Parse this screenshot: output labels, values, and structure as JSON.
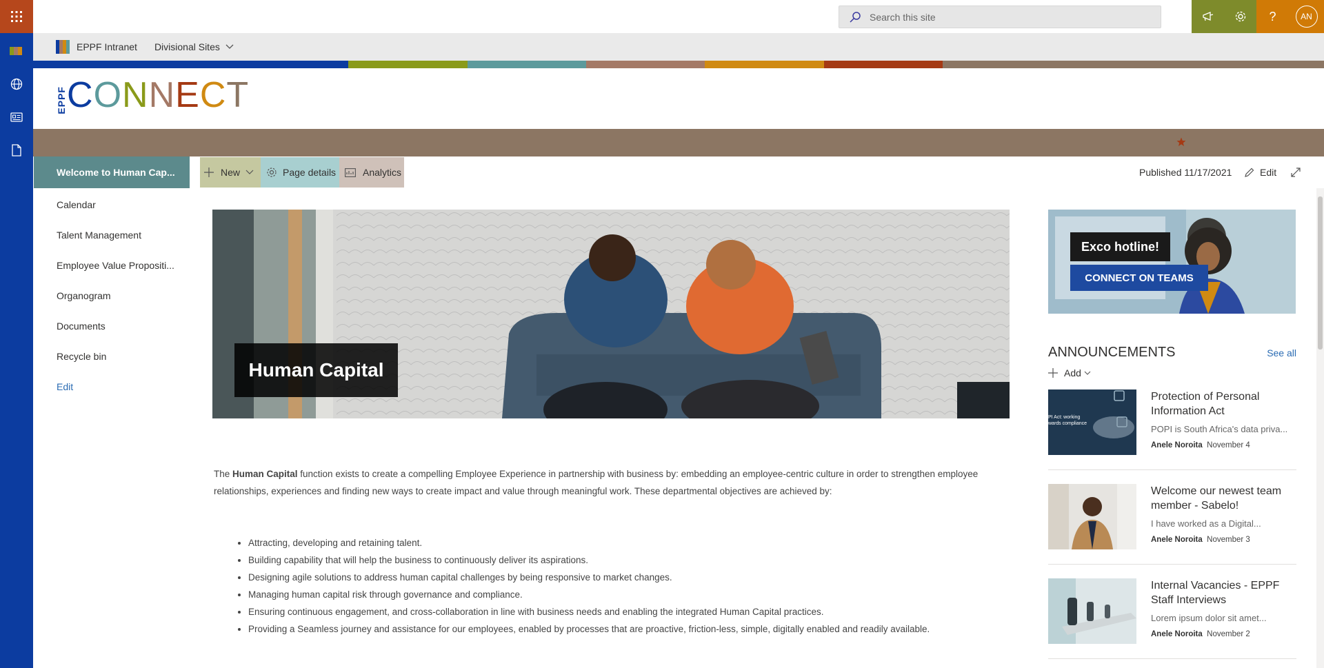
{
  "suite": {
    "search_placeholder": "Search this site",
    "avatar_initials": "AN",
    "icons": [
      "waffle-icon",
      "megaphone-icon",
      "gear-icon",
      "help-icon"
    ],
    "colors": {
      "waffle": "#b6471c",
      "megaphone": "#7e8b2b",
      "gear": "#7e8b2b",
      "help": "#d07a06",
      "avatar": "#d07a06"
    }
  },
  "appbar": {
    "icons": [
      "site-logo-icon",
      "globe-icon",
      "news-icon",
      "document-icon"
    ],
    "color": "#0c3ca0"
  },
  "hubnav": {
    "site_name": "EPPF Intranet",
    "menu_label": "Divisional Sites"
  },
  "stripe_colors": [
    "#0c3ca0",
    "#0c3ca0",
    "#0c3ca0",
    "#8a9a1a",
    "#5c9a9c",
    "#a47966",
    "#d08a12",
    "#a53a14",
    "#8c7663",
    "#8c7663",
    "#8c7663",
    "#8c7663"
  ],
  "logo": {
    "vertical_text": "EPPF",
    "letters": [
      "C",
      "O",
      "N",
      "N",
      "E",
      "C",
      "T"
    ],
    "letter_colors": [
      "#0c3ca0",
      "#5c9a9c",
      "#8a9a1a",
      "#a47966",
      "#a53a14",
      "#d08a12",
      "#8c7663"
    ]
  },
  "leftnav": {
    "active": "Welcome to Human Cap...",
    "items": [
      "Calendar",
      "Talent Management",
      "Employee Value Propositi...",
      "Organogram",
      "Documents",
      "Recycle bin"
    ],
    "edit": "Edit"
  },
  "cmdbar": {
    "new_label": "New",
    "page_details_label": "Page details",
    "analytics_label": "Analytics",
    "published": "Published 11/17/2021",
    "edit_label": "Edit"
  },
  "hero": {
    "title": "Human Capital"
  },
  "intro": {
    "prefix": "The ",
    "bold": "Human Capital",
    "rest": " function exists to create a compelling Employee Experience in partnership with business by:  embedding an employee-centric culture in order to strengthen employee relationships, experiences and finding new ways to create impact and value through meaningful work. These departmental objectives are achieved by:"
  },
  "bullets": [
    "Attracting, developing and retaining talent.",
    "Building capability that will help the business to continuously deliver its aspirations.",
    "Designing agile solutions to address human capital challenges by being responsive to market changes.",
    "Managing human capital risk through governance and compliance.",
    "Ensuring continuous engagement, and cross-collaboration in line with business needs and enabling the integrated Human Capital practices.",
    "Providing a Seamless journey and assistance for our employees, enabled by processes that are proactive, friction-less, simple, digitally enabled and readily available."
  ],
  "promo": {
    "line1": "Exco hotline!",
    "line2": "CONNECT ON TEAMS"
  },
  "announcements": {
    "heading": "ANNOUNCEMENTS",
    "see_all": "See all",
    "add_label": "Add",
    "items": [
      {
        "title": "Protection of Personal Information Act",
        "desc": "POPI is South Africa's data priva...",
        "author": "Anele Noroita",
        "date": "November 4",
        "thumb_text": "PI Act: working\nwards compliance"
      },
      {
        "title": "Welcome our newest team member - Sabelo!",
        "desc": "I have worked as a Digital...",
        "author": "Anele Noroita",
        "date": "November 3"
      },
      {
        "title": "Internal Vacancies - EPPF Staff Interviews",
        "desc": "Lorem ipsum dolor sit amet...",
        "author": "Anele Noroita",
        "date": "November 2"
      }
    ]
  }
}
